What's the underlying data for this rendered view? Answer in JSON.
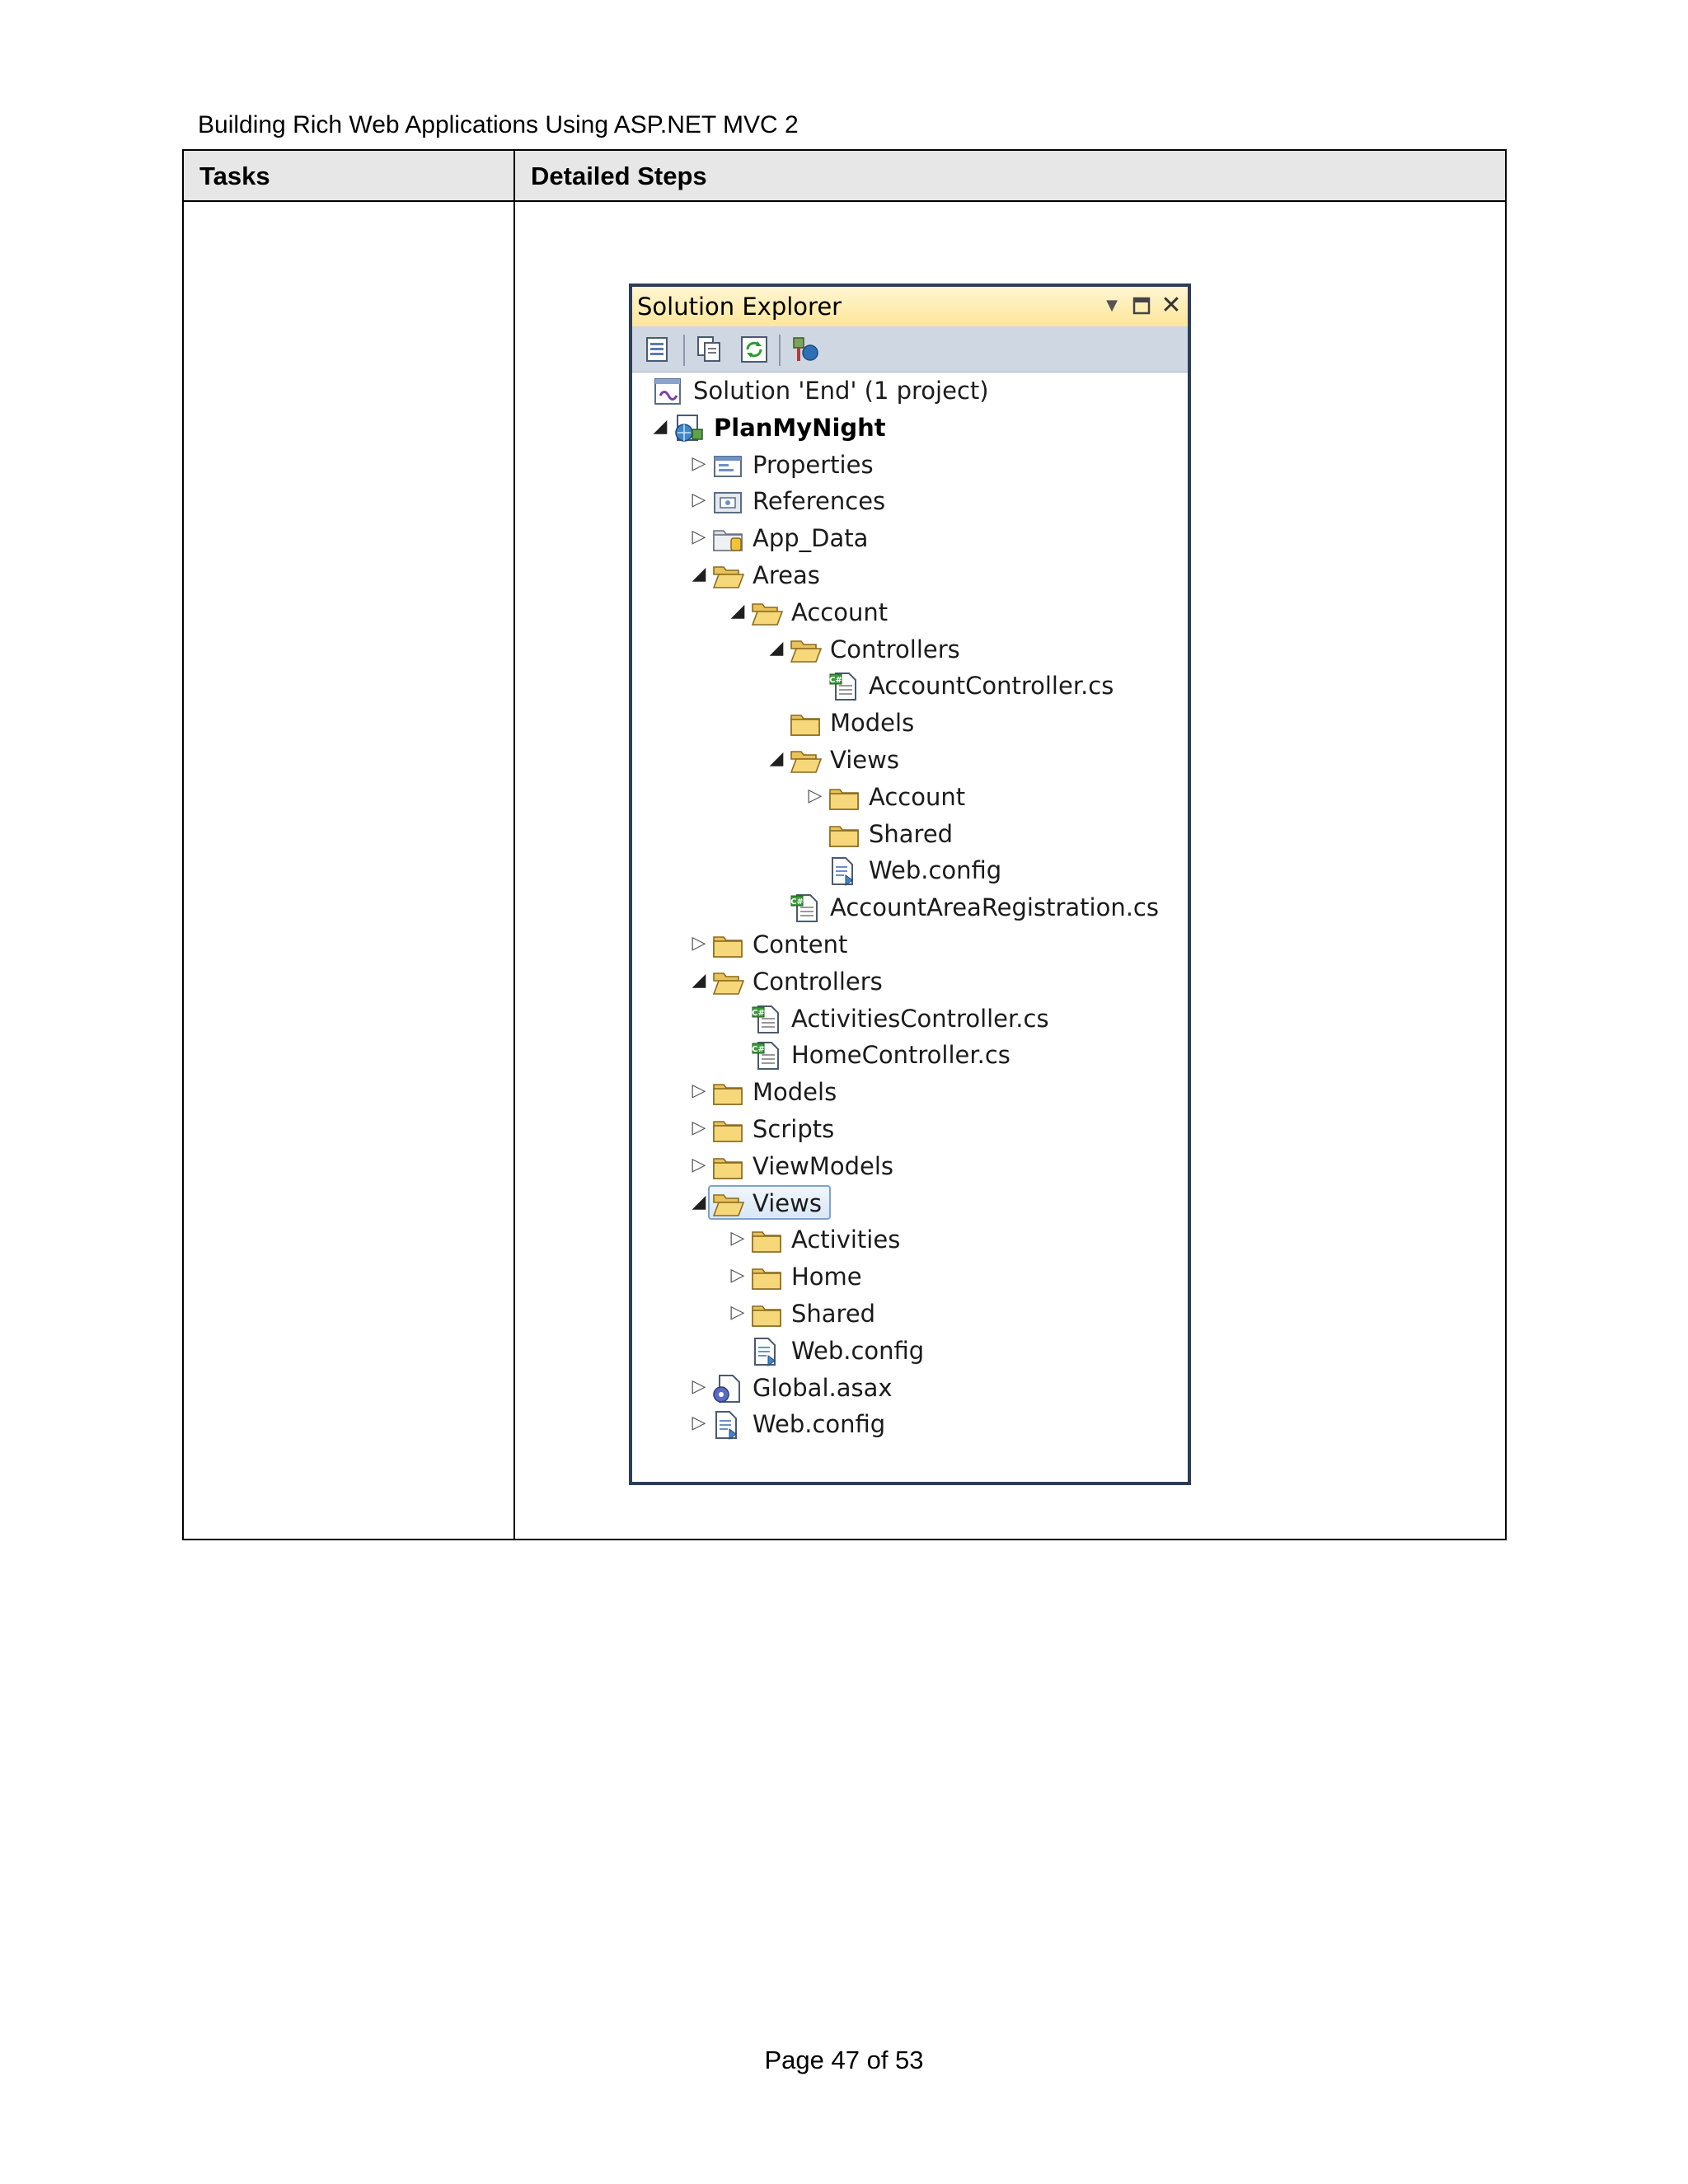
{
  "document": {
    "header": "Building Rich Web Applications Using ASP.NET MVC 2",
    "page_number": "Page 47 of 53"
  },
  "table": {
    "col1_header": "Tasks",
    "col2_header": "Detailed Steps"
  },
  "solution_explorer": {
    "title": "Solution Explorer",
    "toolbar_icons": [
      "properties-icon",
      "show-all-files-icon",
      "refresh-icon",
      "class-diagram-icon"
    ],
    "tree": [
      {
        "label": "Solution 'End' (1 project)",
        "level": 0,
        "expander": "none",
        "icon": "solution-icon"
      },
      {
        "label": "PlanMyNight",
        "level": 0,
        "expander": "expanded",
        "icon": "web-project-icon",
        "bold": true
      },
      {
        "label": "Properties",
        "level": 1,
        "expander": "collapsed",
        "icon": "properties-folder-icon"
      },
      {
        "label": "References",
        "level": 1,
        "expander": "collapsed",
        "icon": "references-icon"
      },
      {
        "label": "App_Data",
        "level": 1,
        "expander": "collapsed",
        "icon": "app-data-folder-icon"
      },
      {
        "label": "Areas",
        "level": 1,
        "expander": "expanded",
        "icon": "open-folder-icon"
      },
      {
        "label": "Account",
        "level": 2,
        "expander": "expanded",
        "icon": "open-folder-icon"
      },
      {
        "label": "Controllers",
        "level": 3,
        "expander": "expanded",
        "icon": "open-folder-icon"
      },
      {
        "label": "AccountController.cs",
        "level": 4,
        "expander": "none",
        "icon": "csharp-file-icon"
      },
      {
        "label": "Models",
        "level": 3,
        "expander": "none",
        "icon": "folder-icon"
      },
      {
        "label": "Views",
        "level": 3,
        "expander": "expanded",
        "icon": "open-folder-icon"
      },
      {
        "label": "Account",
        "level": 4,
        "expander": "collapsed",
        "icon": "folder-icon"
      },
      {
        "label": "Shared",
        "level": 4,
        "expander": "none",
        "icon": "folder-icon"
      },
      {
        "label": "Web.config",
        "level": 4,
        "expander": "none",
        "icon": "config-file-icon"
      },
      {
        "label": "AccountAreaRegistration.cs",
        "level": 3,
        "expander": "none",
        "icon": "csharp-file-icon"
      },
      {
        "label": "Content",
        "level": 1,
        "expander": "collapsed",
        "icon": "folder-icon"
      },
      {
        "label": "Controllers",
        "level": 1,
        "expander": "expanded",
        "icon": "open-folder-icon"
      },
      {
        "label": "ActivitiesController.cs",
        "level": 2,
        "expander": "none",
        "icon": "csharp-file-icon"
      },
      {
        "label": "HomeController.cs",
        "level": 2,
        "expander": "none",
        "icon": "csharp-file-icon"
      },
      {
        "label": "Models",
        "level": 1,
        "expander": "collapsed",
        "icon": "folder-icon"
      },
      {
        "label": "Scripts",
        "level": 1,
        "expander": "collapsed",
        "icon": "folder-icon"
      },
      {
        "label": "ViewModels",
        "level": 1,
        "expander": "collapsed",
        "icon": "folder-icon"
      },
      {
        "label": "Views",
        "level": 1,
        "expander": "expanded",
        "icon": "open-folder-icon",
        "selected": true
      },
      {
        "label": "Activities",
        "level": 2,
        "expander": "collapsed",
        "icon": "folder-icon"
      },
      {
        "label": "Home",
        "level": 2,
        "expander": "collapsed",
        "icon": "folder-icon"
      },
      {
        "label": "Shared",
        "level": 2,
        "expander": "collapsed",
        "icon": "folder-icon"
      },
      {
        "label": "Web.config",
        "level": 2,
        "expander": "none",
        "icon": "config-file-icon"
      },
      {
        "label": "Global.asax",
        "level": 1,
        "expander": "collapsed",
        "icon": "global-asax-icon"
      },
      {
        "label": "Web.config",
        "level": 1,
        "expander": "collapsed",
        "icon": "config-file-icon"
      }
    ]
  }
}
